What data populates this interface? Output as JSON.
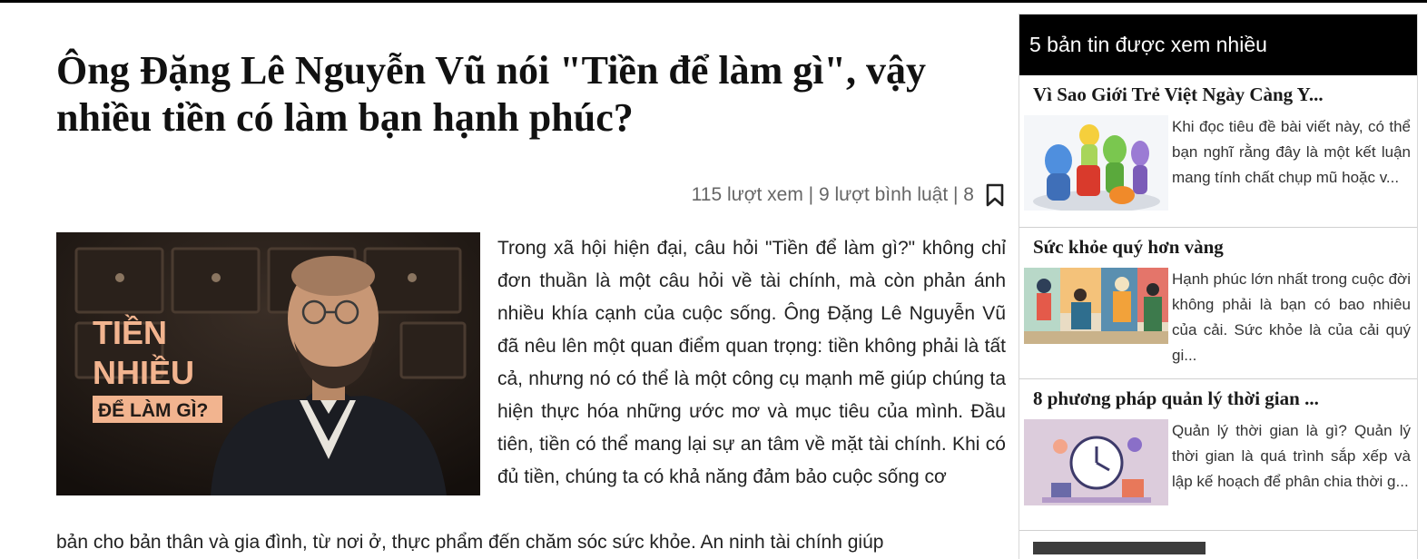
{
  "article": {
    "title": "Ông Đặng Lê Nguyễn Vũ nói \"Tiền để làm gì\", vậy nhiều tiền có làm bạn hạnh phúc?",
    "meta": "115 lượt xem | 9 lượt bình luật | 8",
    "hero": {
      "line1": "TIỀN",
      "line2": "NHIỀU",
      "line3": "ĐỂ LÀM GÌ?"
    },
    "body_main": "Trong xã hội hiện đại, câu hỏi \"Tiền để làm gì?\" không chỉ đơn thuần là một câu hỏi về tài chính, mà còn phản ánh nhiều khía cạnh của cuộc sống. Ông Đặng Lê Nguyễn Vũ đã nêu lên một quan điểm quan trọng: tiền không phải là tất cả, nhưng nó có thể là một công cụ mạnh mẽ giúp chúng ta hiện thực hóa những ước mơ và mục tiêu của mình. Đầu tiên, tiền có thể mang lại sự an tâm về mặt tài chính. Khi có đủ tiền, chúng ta có khả năng đảm bảo cuộc sống cơ",
    "body_cont": "bản cho bản thân và gia đình, từ nơi ở, thực phẩm đến chăm sóc sức khỏe. An ninh tài chính giúp"
  },
  "sidebar": {
    "header": "5 bản tin được xem nhiều",
    "items": [
      {
        "title": "Vì Sao Giới Trẻ Việt Ngày Càng Y...",
        "summary": "Khi đọc tiêu đề bài viết này, có thể bạn nghĩ rằng đây là một kết luận mang tính chất chụp mũ hoặc v..."
      },
      {
        "title": "Sức khỏe quý hơn vàng",
        "summary": "Hạnh phúc lớn nhất trong cuộc đời không phải là bạn có bao nhiêu của cải. Sức khỏe là của cải quý gi..."
      },
      {
        "title": "8 phương pháp quản lý thời gian ...",
        "summary": "Quản lý thời gian là gì? Quản lý thời gian là quá trình sắp xếp và lập kế hoạch để phân chia thời g..."
      }
    ]
  },
  "colors": {
    "header_bg": "#000000",
    "hero_accent": "#f2b48f",
    "meta_text": "#666666"
  }
}
